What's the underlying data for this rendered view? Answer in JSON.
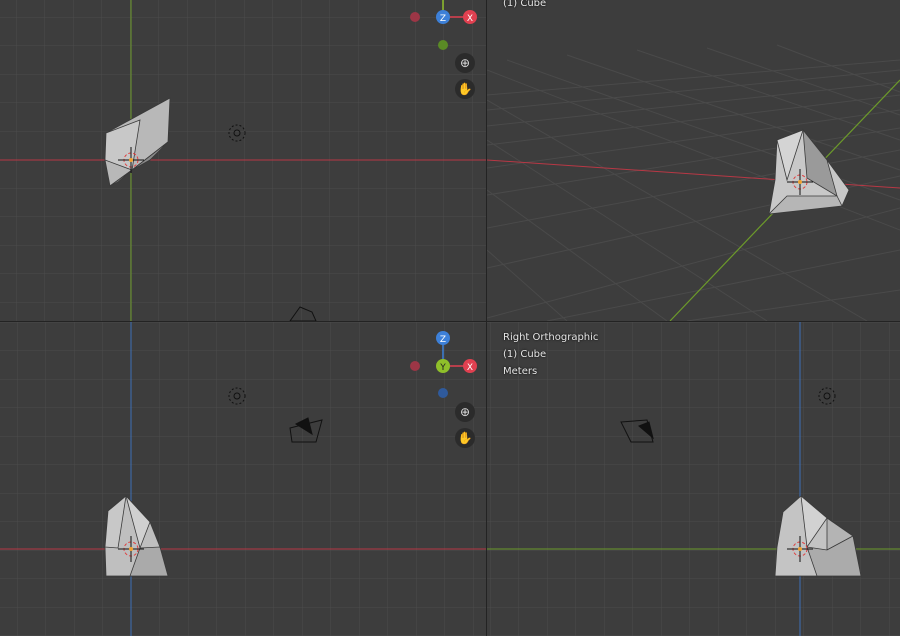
{
  "viewports": {
    "top_left": {
      "name": "",
      "object": "",
      "units": ""
    },
    "top_right": {
      "object": "(1) Cube"
    },
    "bottom_left": {
      "name": "",
      "object": "",
      "units": ""
    },
    "bottom_right": {
      "name": "Right Orthographic",
      "object": "(1) Cube",
      "units": "Meters"
    }
  },
  "gizmos": {
    "top_left": {
      "axis1": "Z",
      "axis2": "X"
    },
    "bottom_left": {
      "axis_top": "Z",
      "axis_mid": "Y",
      "axis_right": "X"
    }
  },
  "nav": {
    "zoom_glyph": "⊕",
    "pan_glyph": "✋"
  },
  "colors": {
    "x_axis": "#b83845",
    "y_axis": "#6c9a2a",
    "z_axis": "#3d6fb8",
    "grid": "#4a4a4a",
    "mesh": "#b0b0b0"
  }
}
